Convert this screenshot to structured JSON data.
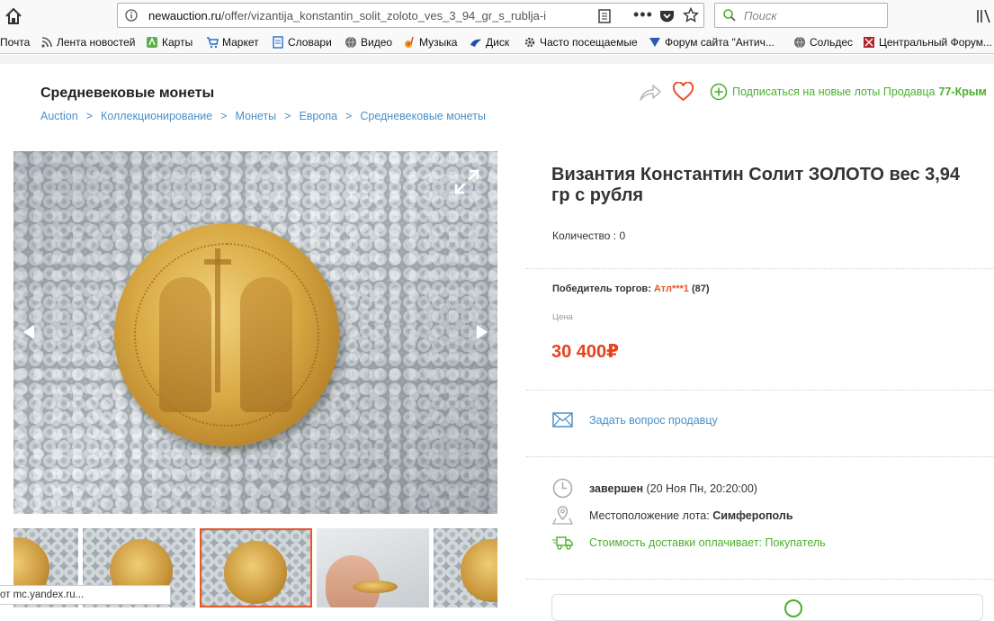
{
  "browser": {
    "url_host": "newauction.ru",
    "url_path": "/offer/vizantija_konstantin_solit_zoloto_ves_3_94_gr_s_rublja-i",
    "search_placeholder": "Поиск",
    "bookmarks": [
      {
        "label": "Почта",
        "icon": "mail-icon"
      },
      {
        "label": "Лента новостей",
        "icon": "rss-icon"
      },
      {
        "label": "Карты",
        "icon": "maps-icon"
      },
      {
        "label": "Маркет",
        "icon": "cart-icon"
      },
      {
        "label": "Словари",
        "icon": "book-icon"
      },
      {
        "label": "Видео",
        "icon": "globe-icon"
      },
      {
        "label": "Музыка",
        "icon": "music-icon"
      },
      {
        "label": "Диск",
        "icon": "disk-icon"
      },
      {
        "label": "Часто посещаемые",
        "icon": "gear-icon"
      },
      {
        "label": "Форум сайта \"Антич...",
        "icon": "forum-icon"
      },
      {
        "label": "Сольдес",
        "icon": "globe-icon"
      },
      {
        "label": "Центральный Форум...",
        "icon": "forum-icon"
      }
    ],
    "status_tip": "от mc.yandex.ru..."
  },
  "header": {
    "category_title": "Средневековые монеты",
    "breadcrumb": [
      "Auction",
      "Коллекционирование",
      "Монеты",
      "Европа",
      "Средневековые монеты"
    ],
    "subscribe_text": "Подписаться на новые лоты Продавца",
    "seller": "77-Крым"
  },
  "lot": {
    "title": "Византия Константин Солит ЗОЛОТО вес 3,94 гр с рубля",
    "quantity": "Количество : 0",
    "winner_label": "Победитель торгов:",
    "winner_name": "Атл***1",
    "winner_rating": "(87)",
    "price_label": "Цена",
    "price": "30 400₽",
    "ask_seller": "Задать вопрос продавцу",
    "status": "завершен",
    "end_date": "(20 Ноя Пн, 20:20:00)",
    "location_label": "Местоположение лота:",
    "location": "Симферополь",
    "delivery": "Стоимость доставки оплачивает: Покупатель"
  },
  "colors": {
    "accent_blue": "#4a90c8",
    "price_red": "#e8411c",
    "green": "#4caf2e",
    "selected_thumb": "#e8562a"
  }
}
